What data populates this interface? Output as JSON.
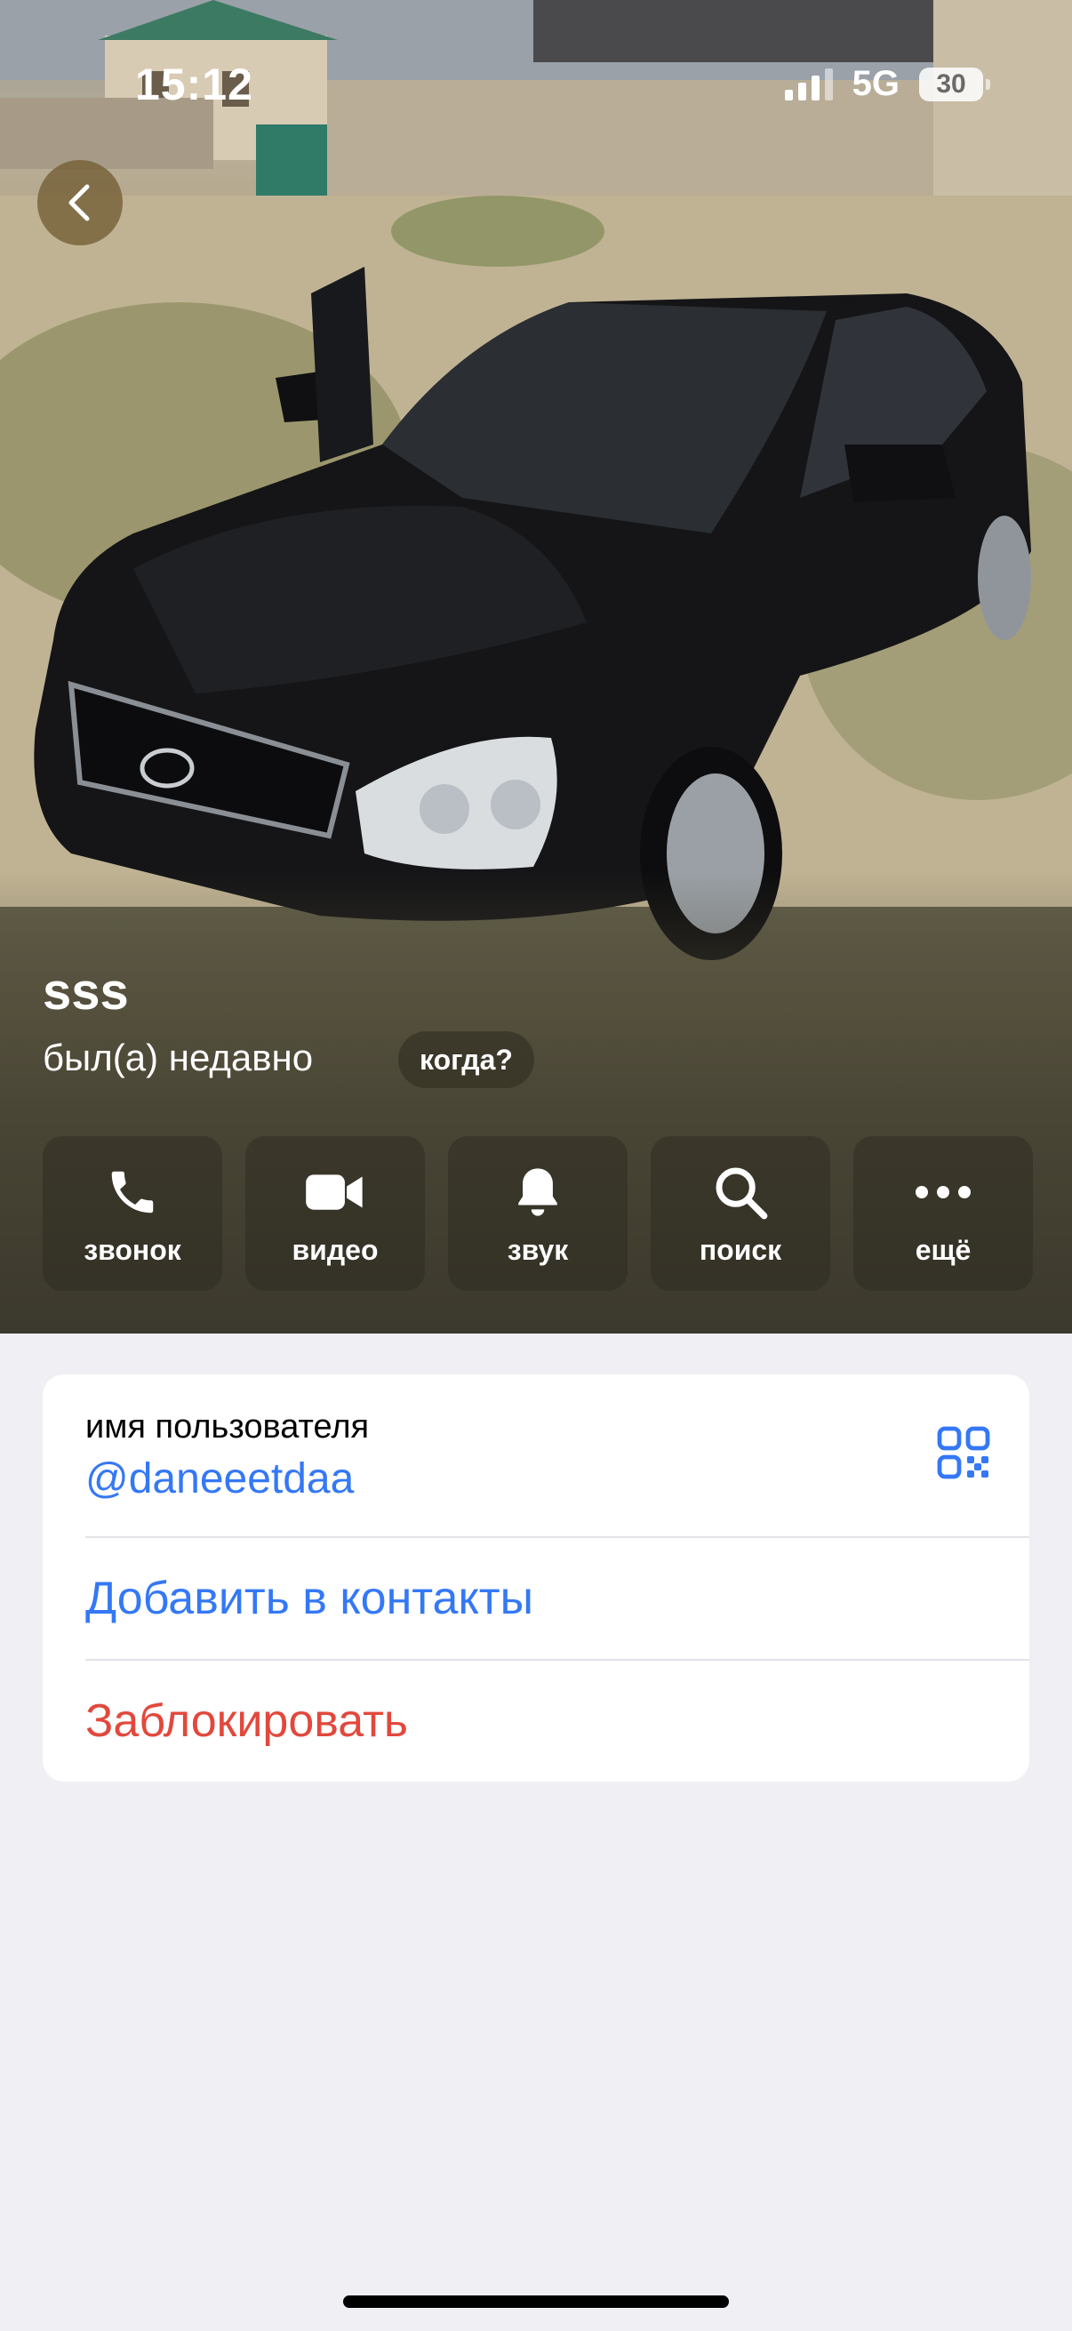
{
  "status_bar": {
    "time": "15:12",
    "network": "5G",
    "battery": "30"
  },
  "header": {
    "photo": "profile-photo",
    "back_icon": "chevron-left-icon"
  },
  "profile": {
    "name": "sss",
    "last_seen": "был(а) недавно",
    "when_button": "когда?"
  },
  "actions": [
    {
      "label": "звонок",
      "icon": "phone-icon"
    },
    {
      "label": "видео",
      "icon": "video-camera-icon"
    },
    {
      "label": "звук",
      "icon": "bell-icon"
    },
    {
      "label": "поиск",
      "icon": "search-icon"
    },
    {
      "label": "ещё",
      "icon": "more-icon"
    }
  ],
  "info": {
    "username_label": "имя пользователя",
    "username": "@daneeetdaa",
    "add_contact": "Добавить в контакты",
    "block": "Заблокировать"
  },
  "colors": {
    "accent": "#3478f6",
    "destructive": "#e2483c",
    "background": "#efeff4"
  }
}
